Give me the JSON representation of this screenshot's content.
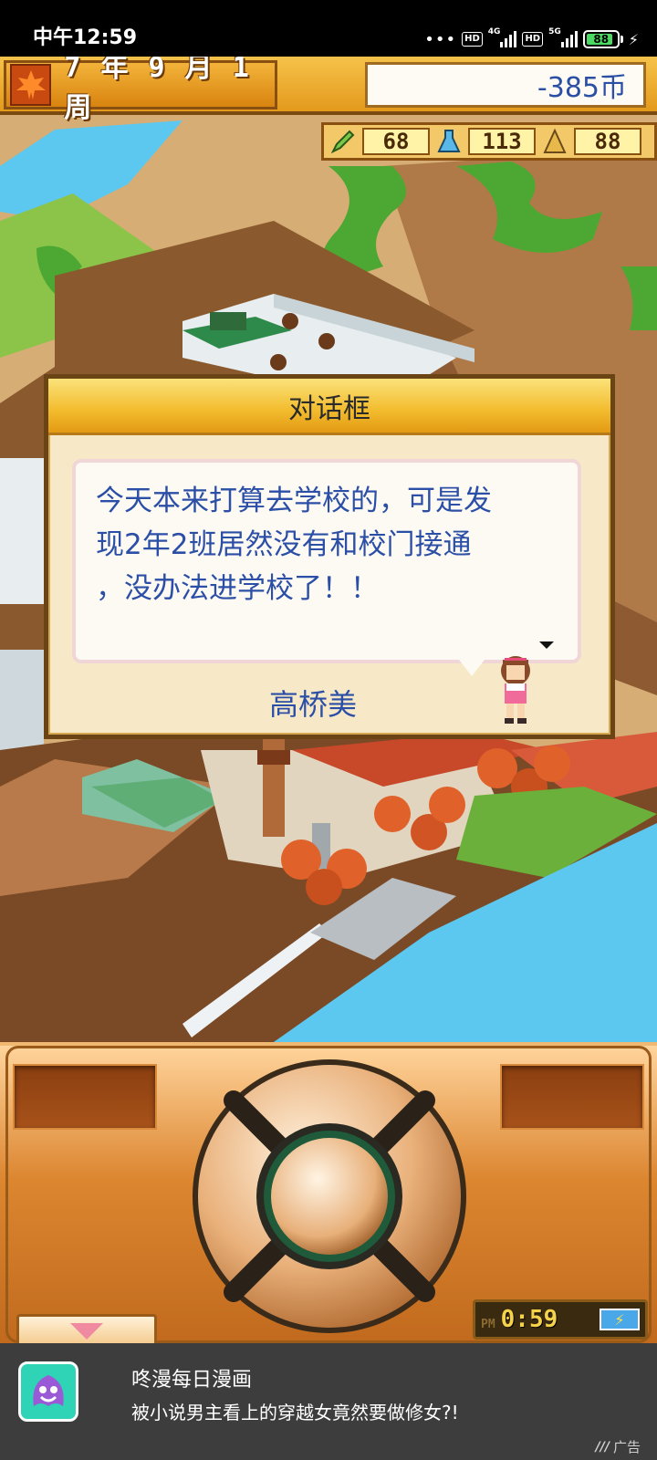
{
  "status_bar": {
    "time": "中午12:59",
    "dots": "•••",
    "hd1": "HD",
    "net1": "4G",
    "hd2": "HD",
    "net2": "5G",
    "battery": "88"
  },
  "hud": {
    "date": "7 年 9 月 1 周",
    "coins": "-385币",
    "stats": [
      "68",
      "113",
      "88"
    ]
  },
  "dialog": {
    "title": "对话框",
    "message_lines": [
      "今天本来打算去学校的，可是发",
      "现2年2班居然没有和校门接通",
      "，没办法进学校了！！"
    ],
    "speaker": "高桥美"
  },
  "controller": {
    "period": "PM",
    "time": "0:59"
  },
  "ad": {
    "title": "咚漫每日漫画",
    "description": "被小说男主看上的穿越女竟然要做修女?!",
    "label": "广告"
  },
  "colors": {
    "dialog_text": "#2b4fa6",
    "hud_gold": "#f2bb2c",
    "water": "#5cc8f0"
  }
}
